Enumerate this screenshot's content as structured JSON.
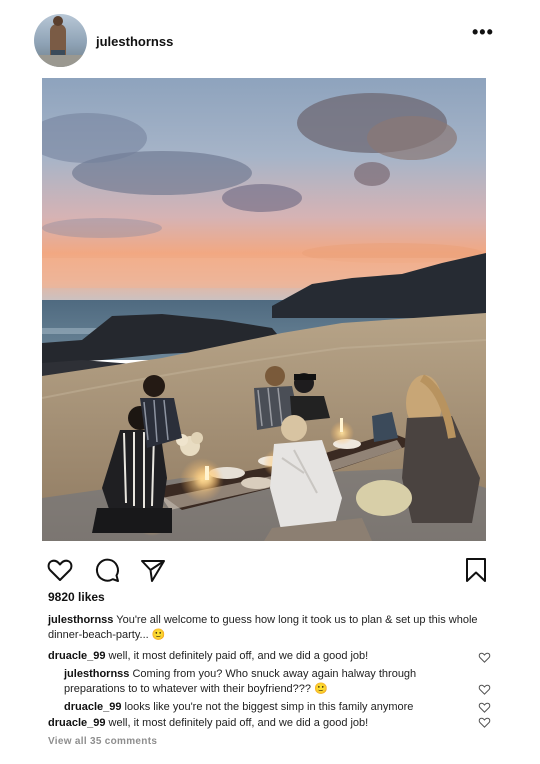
{
  "header": {
    "username": "julesthornss"
  },
  "actions": {
    "like_icon": "heart-icon",
    "comment_icon": "comment-icon",
    "share_icon": "send-icon",
    "save_icon": "bookmark-icon"
  },
  "likes": "9820 likes",
  "caption": {
    "username": "julesthornss",
    "text": "You're all welcome to guess how long it took us to plan & set up this whole dinner-beach-party... 🙂"
  },
  "comments": [
    {
      "username": "druacle_99",
      "text": "well, it most definitely paid off, and we did a good job!"
    },
    {
      "username": "julesthornss",
      "text": "Coming from you? Who snuck away again halway through preparations to to whatever with their boyfriend??? 🙂"
    },
    {
      "username": "druacle_99",
      "text": "looks like you're not the biggest simp in this family anymore"
    },
    {
      "username": "druacle_99",
      "text": "well, it most definitely paid off, and we did a good job!"
    }
  ],
  "view_all": "View all 35 comments",
  "colors": {
    "text": "#262626",
    "muted": "#8e8e8e",
    "sky_top": "#7d93ad",
    "sunset": "#f0a882",
    "sand": "#a89378"
  }
}
